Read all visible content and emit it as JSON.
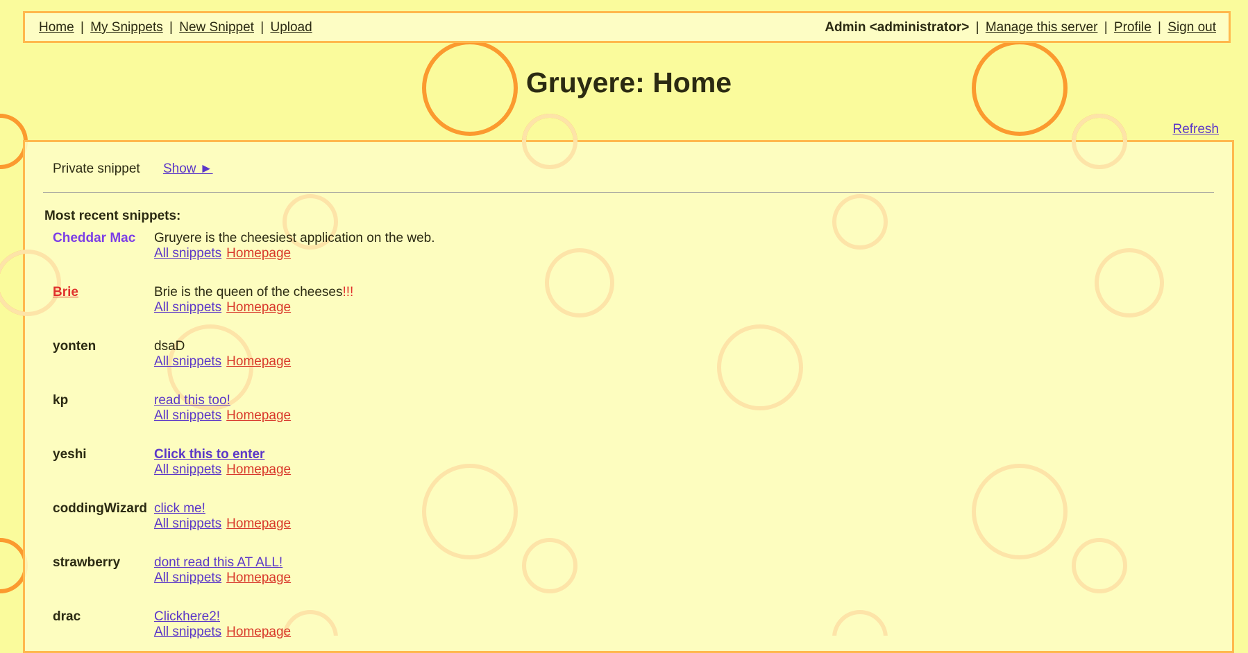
{
  "menu": {
    "home": "Home",
    "my_snippets": "My Snippets",
    "new_snippet": "New Snippet",
    "upload": "Upload",
    "user": "Admin <administrator>",
    "manage": "Manage this server",
    "profile": "Profile",
    "sign_out": "Sign out",
    "separator": "|"
  },
  "page": {
    "title": "Gruyere: Home",
    "refresh": "Refresh"
  },
  "private_snippet": {
    "label": "Private snippet",
    "show": "Show ►"
  },
  "recent": {
    "heading": "Most recent snippets:",
    "all_snippets_label": "All snippets",
    "homepage_label": "Homepage",
    "items": [
      {
        "user": "Cheddar Mac",
        "text": "Gruyere is the cheesiest application on the web."
      },
      {
        "user": "Brie",
        "text": "Brie is the queen of the cheeses",
        "emphasis": "!!!"
      },
      {
        "user": "yonten",
        "text": "dsaD"
      },
      {
        "user": "kp",
        "text": "read this too!"
      },
      {
        "user": "yeshi",
        "text": "Click this to enter"
      },
      {
        "user": "coddingWizard",
        "text": "click me!"
      },
      {
        "user": "strawberry",
        "text": "dont read this AT ALL!"
      },
      {
        "user": "drac",
        "text": "Clickhere2!"
      }
    ]
  },
  "colors": {
    "background": "#fafb9c",
    "panel": "#fdfdc4",
    "border": "#ffb84d",
    "link_purple": "#5b37c8",
    "link_red": "#d8382a",
    "circle_orange": "#fb9a2f",
    "circle_faint": "#fde4a8"
  }
}
